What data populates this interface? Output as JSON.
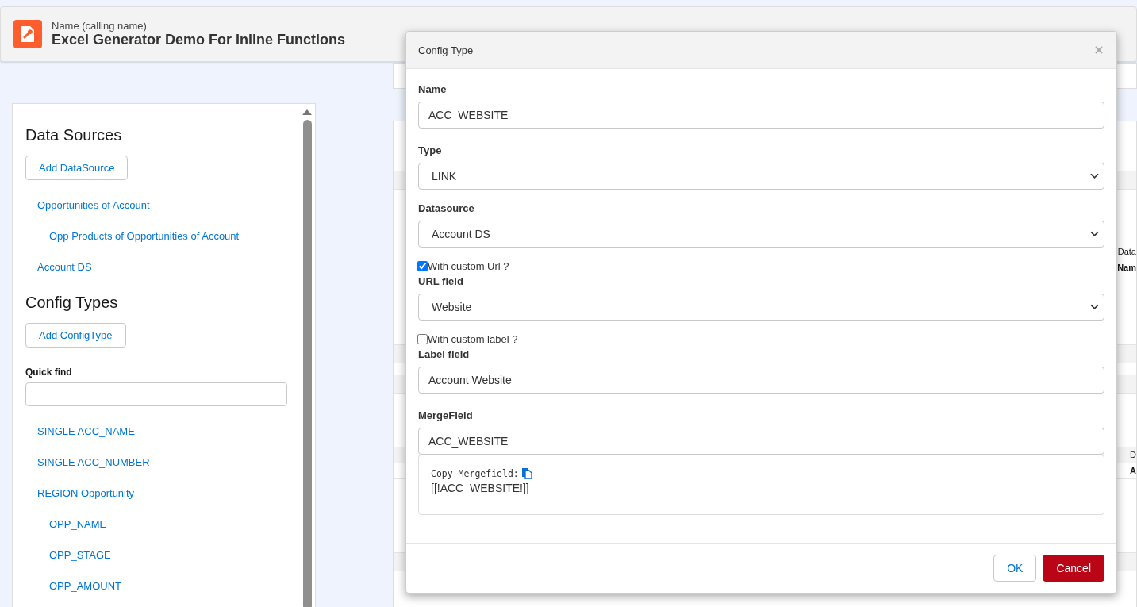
{
  "header": {
    "subtitle": "Name (calling name)",
    "title": "Excel Generator Demo For Inline Functions"
  },
  "sidebar": {
    "sections": [
      {
        "heading": "Data Sources",
        "button": "Add DataSource",
        "items": [
          {
            "label": "Opportunities of Account",
            "children": [
              {
                "label": "Opp Products of Opportunities of Account"
              }
            ]
          },
          {
            "label": "Account DS"
          }
        ]
      },
      {
        "heading": "Config Types",
        "button": "Add ConfigType",
        "quick_find": {
          "label": "Quick find"
        },
        "items": [
          {
            "label": "SINGLE ACC_NAME"
          },
          {
            "label": "SINGLE ACC_NUMBER"
          },
          {
            "label": "REGION Opportunity",
            "children": [
              {
                "label": "OPP_NAME"
              },
              {
                "label": "OPP_STAGE"
              },
              {
                "label": "OPP_AMOUNT"
              }
            ]
          }
        ]
      }
    ]
  },
  "background_fragments": [
    {
      "text": "Data",
      "bold": false
    },
    {
      "text": "Nam",
      "bold": true
    },
    {
      "text": "D",
      "bold": false
    },
    {
      "text": "A",
      "bold": true
    }
  ],
  "dialog": {
    "title": "Config Type",
    "fields": [
      {
        "kind": "input",
        "label": "Name",
        "value": "ACC_WEBSITE"
      },
      {
        "kind": "select",
        "label": "Type",
        "value": "LINK"
      },
      {
        "kind": "select",
        "label": "Datasource",
        "value": "Account DS"
      },
      {
        "kind": "checkbox",
        "label": "With custom Url ?",
        "checked": true
      },
      {
        "kind": "select",
        "label": "URL field",
        "value": "Website"
      },
      {
        "kind": "checkbox",
        "label": "With custom label ?",
        "checked": false
      },
      {
        "kind": "input",
        "label": "Label field",
        "value": "Account Website"
      },
      {
        "kind": "input",
        "label": "MergeField",
        "value": "ACC_WEBSITE"
      }
    ],
    "copy": {
      "label": "Copy Mergefield:",
      "value": "[[!ACC_WEBSITE!]]"
    },
    "buttons": [
      {
        "label": "OK",
        "kind": "neutral"
      },
      {
        "label": "Cancel",
        "kind": "danger"
      }
    ]
  }
}
